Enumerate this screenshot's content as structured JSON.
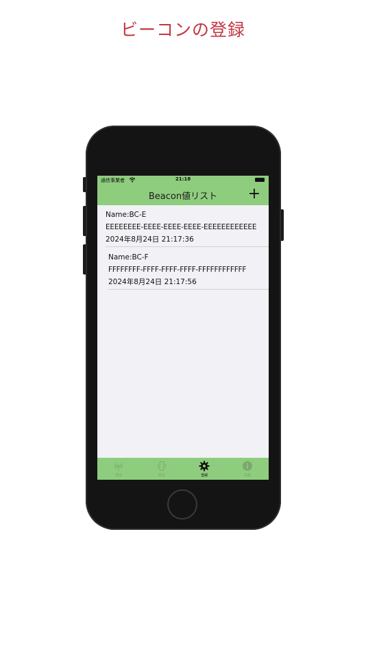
{
  "promo": {
    "title": "ビーコンの登録"
  },
  "status_bar": {
    "carrier": "通信事業者",
    "time": "21:18"
  },
  "nav": {
    "title": "Beacon値リスト",
    "add_icon": "+"
  },
  "beacons": [
    {
      "name": "Name:BC-E",
      "uuid": "EEEEEEEE-EEEE-EEEE-EEEE-EEEEEEEEEEEE",
      "date": "2024年8月24日 21:17:36"
    },
    {
      "name": "Name:BC-F",
      "uuid": "FFFFFFFF-FFFF-FFFF-FFFF-FFFFFFFFFFFF",
      "date": "2024年8月24日 21:17:56"
    }
  ],
  "tabs": [
    {
      "label": "発信",
      "icon": "antenna-icon",
      "active": false
    },
    {
      "label": "受信",
      "icon": "phone-vibrate-icon",
      "active": false
    },
    {
      "label": "登録",
      "icon": "gear-icon",
      "active": true
    },
    {
      "label": "情報",
      "icon": "info-icon",
      "active": false
    }
  ],
  "colors": {
    "accent_green": "#8fcd7e",
    "title_red": "#c23743",
    "list_bg": "#f2f2f6"
  }
}
